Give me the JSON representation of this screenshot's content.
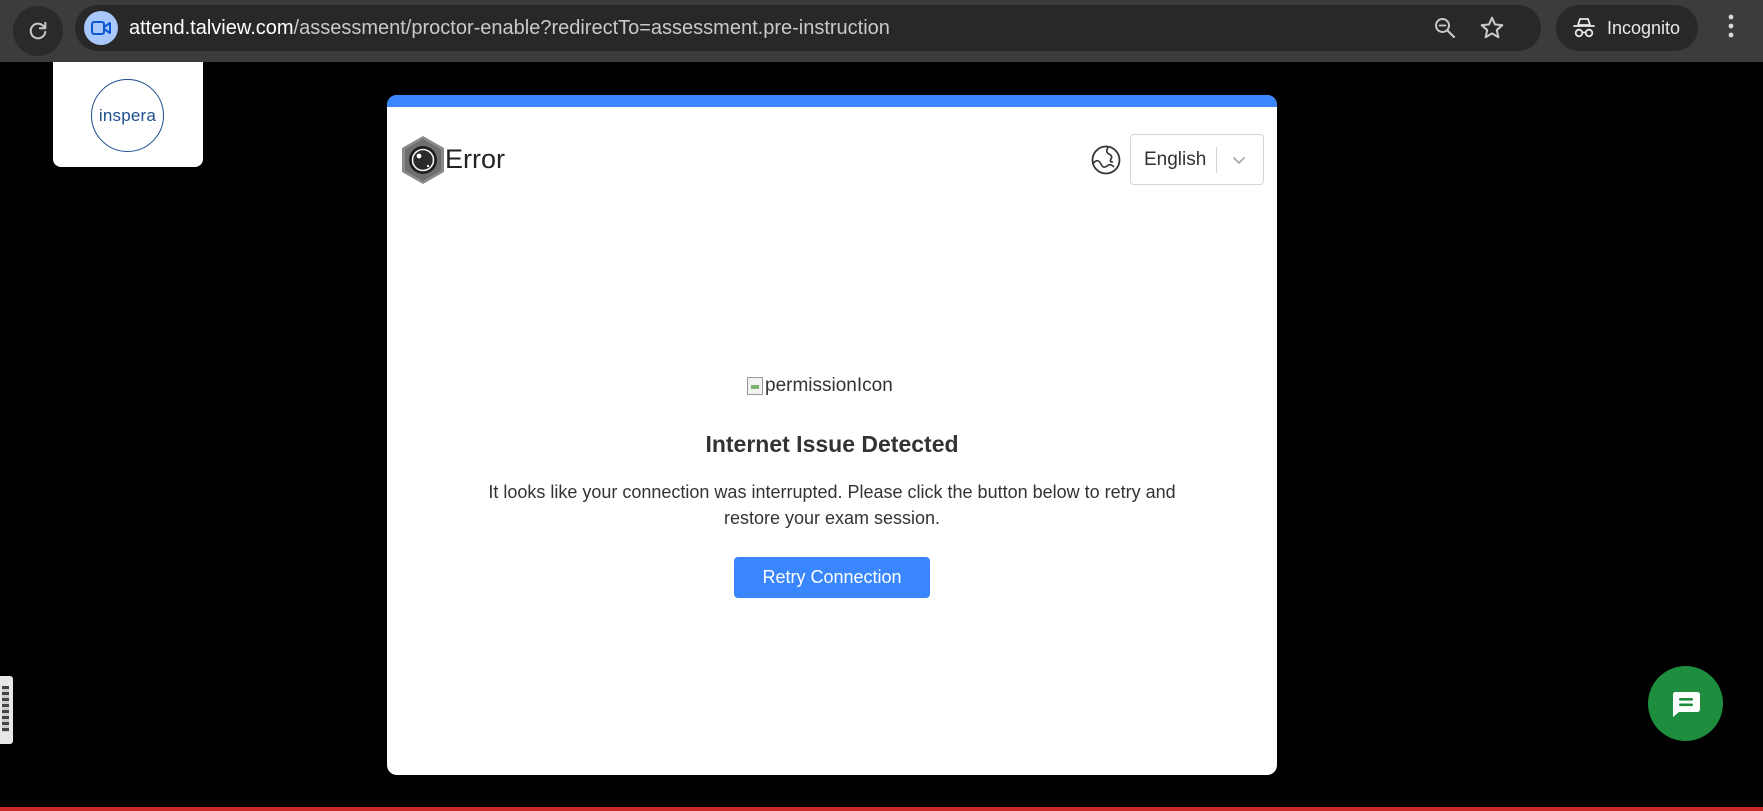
{
  "browser": {
    "url_host": "attend.talview.com",
    "url_path": "/assessment/proctor-enable?redirectTo=assessment.pre-instruction",
    "incognito_label": "Incognito",
    "icons": [
      "reload-icon",
      "camera-icon",
      "zoom-icon",
      "star-icon",
      "incognito-icon",
      "more-vert-icon"
    ]
  },
  "page": {
    "brand_logo_text": "inspera",
    "card": {
      "title": "Error",
      "language_selected": "English",
      "image_alt": "permissionIcon",
      "heading": "Internet Issue Detected",
      "message": "It looks like your connection was interrupted. Please click the button below to retry and restore your exam session.",
      "retry_label": "Retry Connection"
    }
  },
  "colors": {
    "accent": "#3a86ff",
    "chat_button": "#1e8e3e",
    "chrome_bg": "#3c3c3c",
    "omnibox_bg": "#282828"
  }
}
